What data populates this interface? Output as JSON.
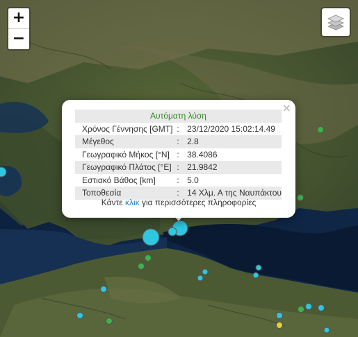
{
  "map": {
    "zoom_in_label": "+",
    "zoom_out_label": "−",
    "layers_icon": "layers-icon",
    "marker_colors": {
      "cyan": "#2ec6e0",
      "green": "#3db24a",
      "yellow": "#e2d22c",
      "outline": "#555555"
    }
  },
  "popup": {
    "close_label": "×",
    "header": "Αυτόματη λύση",
    "rows": [
      {
        "label": "Χρόνος Γέννησης [GMT]",
        "value": "23/12/2020 15:02:14.49"
      },
      {
        "label": "Μέγεθος",
        "value": "2.8"
      },
      {
        "label": "Γεωγραφικό Μήκος [°N]",
        "value": "38.4086"
      },
      {
        "label": "Γεωγραφικό Πλάτος [°E]",
        "value": "21.9842"
      },
      {
        "label": "Εστιακό Βάθος [km]",
        "value": "5.0"
      },
      {
        "label": "Τοποθεσία",
        "value": "14 Χλμ. Α της Ναυπάκτου"
      }
    ],
    "separator": ":",
    "footer_before": "Κάντε ",
    "footer_link": "κλικ",
    "footer_after": " για περισσότερες πληροφορίες",
    "header_color": "#2e8b1e",
    "link_color": "#1a7fc7"
  }
}
